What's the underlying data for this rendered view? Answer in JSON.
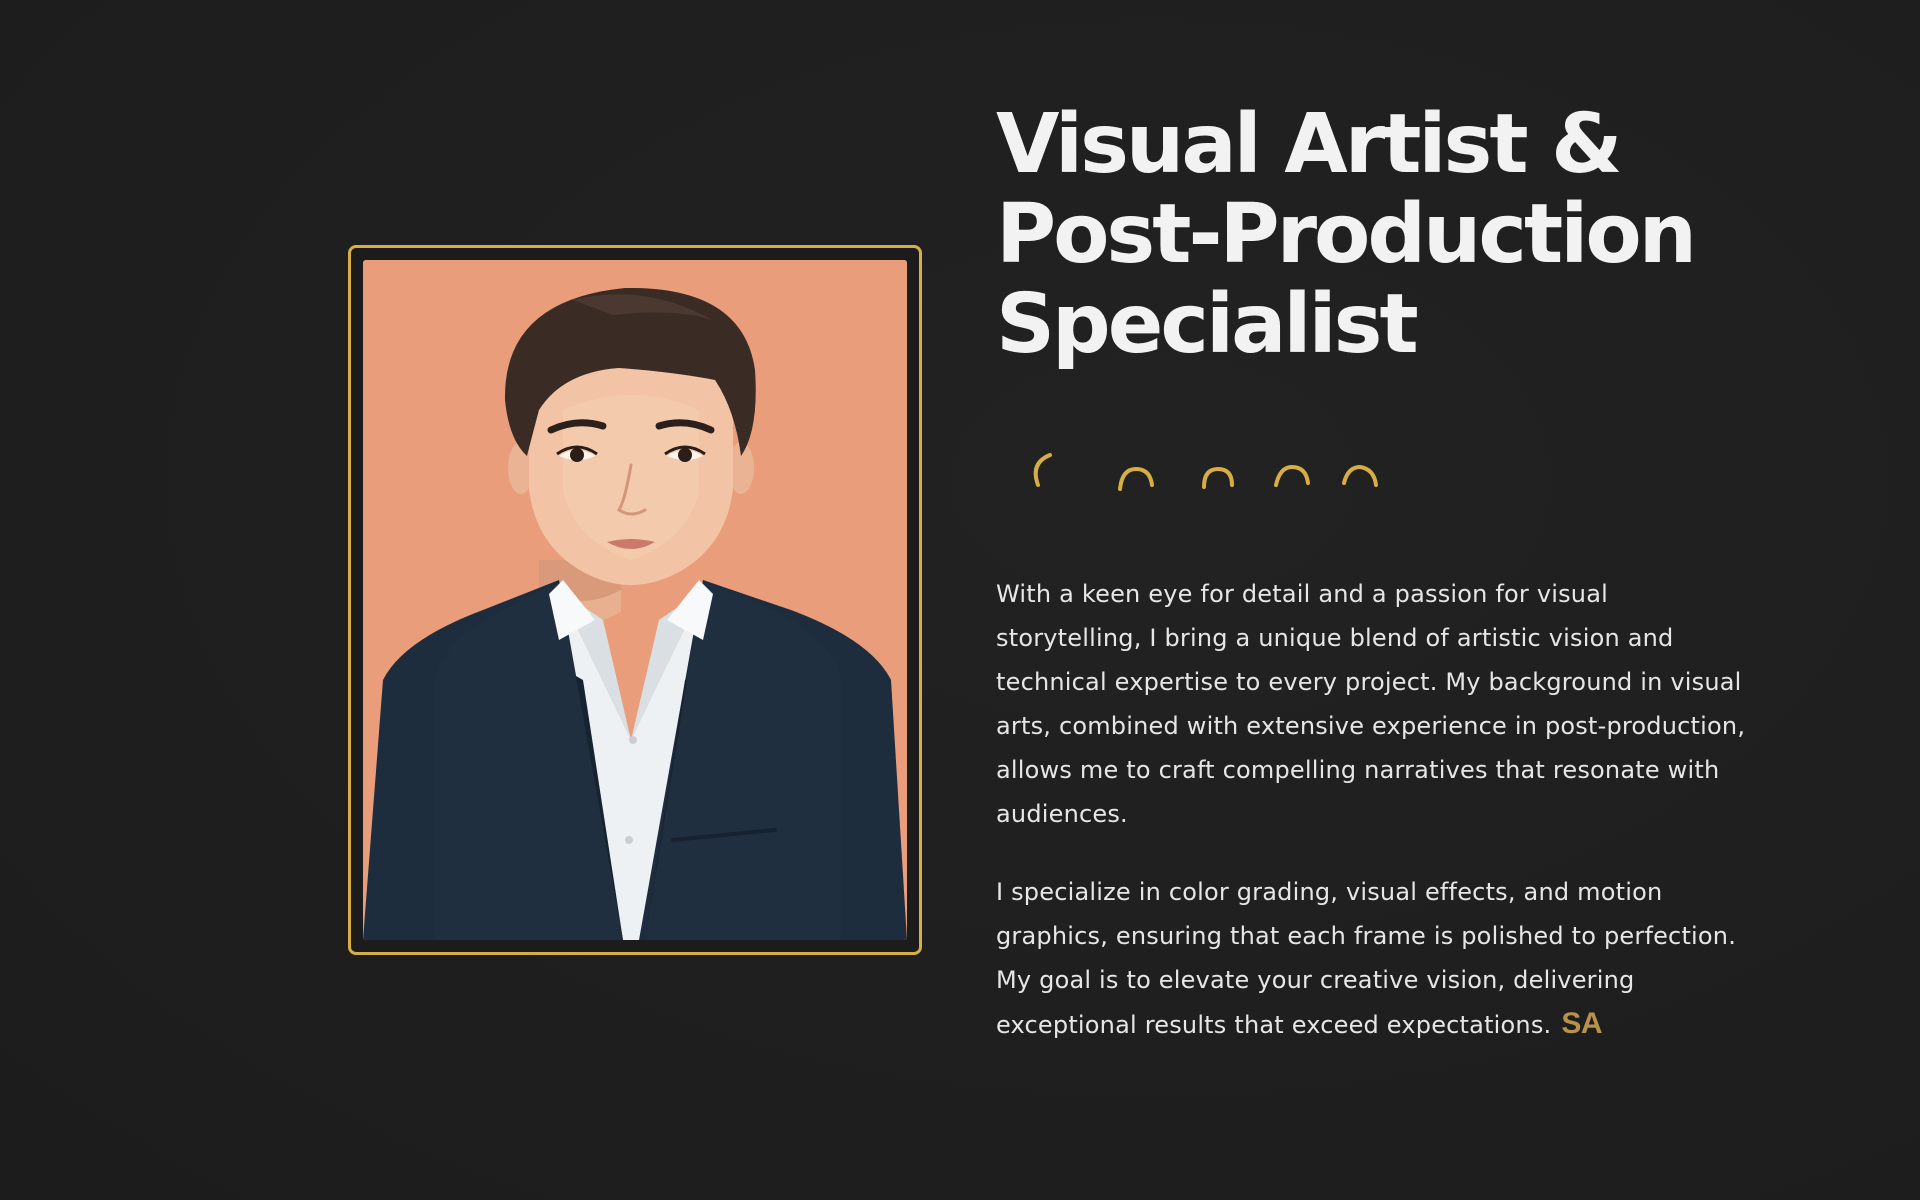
{
  "header": {
    "title_lines": [
      "Visual Artist &",
      "Post-Production",
      "Specialist"
    ]
  },
  "bio": {
    "paragraph_1": "With a keen eye for detail and a passion for visual storytelling, I bring a unique blend of artistic vision and technical expertise to every project. My background in visual arts, combined with extensive experience in post-production, allows me to craft compelling narratives that resonate with audiences.",
    "paragraph_2": "I specialize in color grading, visual effects, and motion graphics, ensuring that each frame is polished to perfection. My goal is to elevate your creative vision, delivering exceptional results that exceed expectations.",
    "signature": "SA"
  },
  "portrait": {
    "icon": "portrait-illustration",
    "background_color": "#eb9f7d",
    "frame_color": "#d7ad45"
  },
  "decor": {
    "icon": "loading-arcs-icon",
    "color": "#d7ad45"
  },
  "colors": {
    "background": "#1f1f1f",
    "text": "#e6e6e6",
    "accent": "#d7ad45",
    "signature": "#b8914b"
  }
}
